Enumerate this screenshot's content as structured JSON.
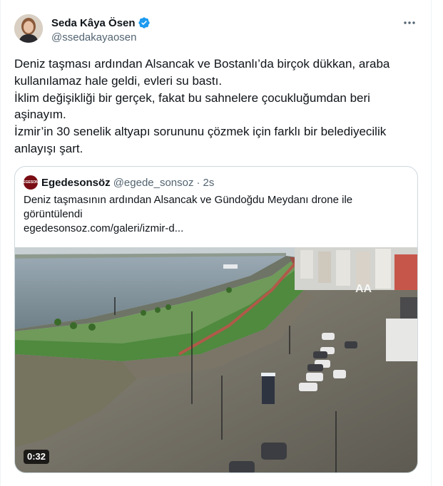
{
  "author": {
    "name": "Seda Kâya Ösen",
    "handle": "@ssedakayaosen",
    "verified": true
  },
  "tweet": {
    "lines": [
      "Deniz taşması ardından Alsancak ve Bostanlı’da birçok dükkan, araba kullanılamaz hale geldi, evleri su bastı.",
      "İklim değişikliği bir gerçek, fakat bu sahnelere çocukluğumdan beri aşinayım.",
      "İzmir’in 30 senelik altyapı sorununu çözmek için farklı bir belediyecilik anlayışı şart."
    ]
  },
  "quote": {
    "avatar_text": "EGESON",
    "name": "Egedesonsöz",
    "handle": "@egede_sonsoz",
    "separator": "·",
    "time": "2s",
    "text_line1": "Deniz taşmasının ardından Alsancak ve Gündoğdu Meydanı drone ile",
    "text_line2": "görüntülendi",
    "link": "egedesonsoz.com/galeri/izmir-d...",
    "media": {
      "duration": "0:32",
      "watermark": "AA",
      "alt_subject": "flooded waterfront street aerial drone view"
    }
  },
  "icons": {
    "verified": "verified-badge-icon",
    "more": "more-options-icon"
  },
  "colors": {
    "verified_blue": "#1d9bf0",
    "secondary_text": "#536471",
    "border": "#cfd9de"
  }
}
